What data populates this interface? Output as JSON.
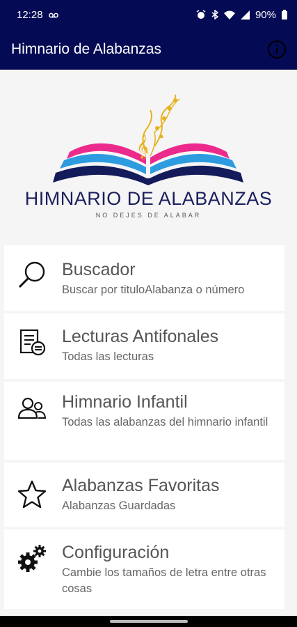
{
  "status_bar": {
    "time": "12:28",
    "battery": "90%"
  },
  "app_bar": {
    "title": "Himnario de Alabanzas"
  },
  "logo": {
    "title": "HIMNARIO DE ALABANZAS",
    "subtitle": "NO DEJES DE ALABAR",
    "colors": {
      "pink": "#ec2a8c",
      "blue": "#2d9be0",
      "navy": "#141b5b",
      "gold": "#e7b21e"
    }
  },
  "menu": {
    "items": [
      {
        "icon": "search-icon",
        "title": "Buscador",
        "subtitle": "Buscar por tituloAlabanza o número"
      },
      {
        "icon": "document-icon",
        "title": "Lecturas Antifonales",
        "subtitle": "Todas las lecturas"
      },
      {
        "icon": "users-icon",
        "title": "Himnario Infantil",
        "subtitle": "Todas las alabanzas del himnario infantil"
      },
      {
        "icon": "star-icon",
        "title": "Alabanzas Favoritas",
        "subtitle": "Alabanzas Guardadas"
      },
      {
        "icon": "gears-icon",
        "title": "Configuración",
        "subtitle": "Cambie los tamaños de letra entre otras cosas"
      }
    ]
  },
  "colors": {
    "app_bar": "#050a54",
    "background": "#f5f5f5"
  }
}
